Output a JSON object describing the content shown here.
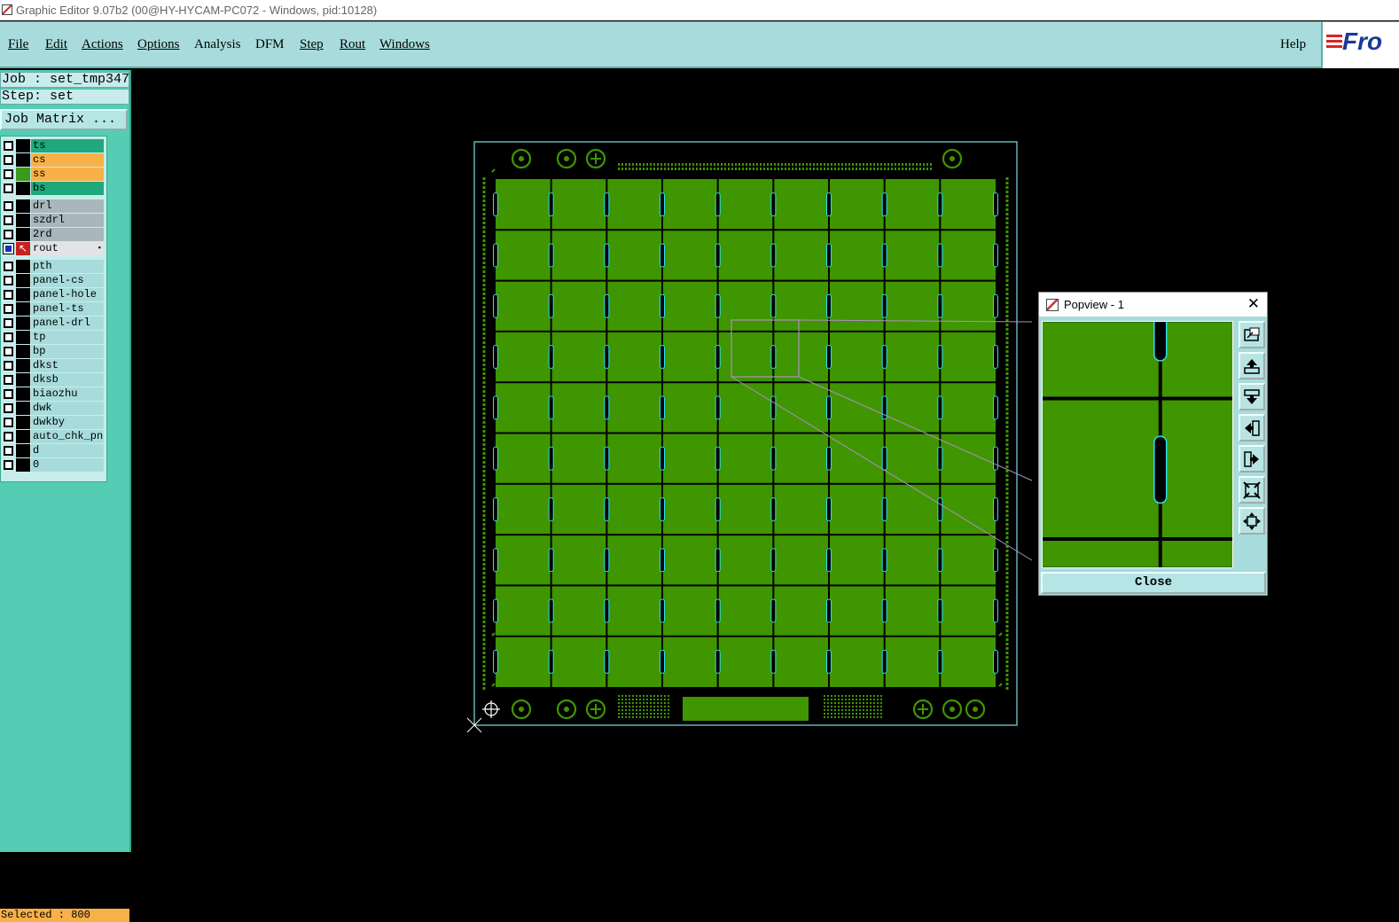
{
  "window": {
    "title": "Graphic Editor 9.07b2 (00@HY-HYCAM-PC072 - Windows, pid:10128)"
  },
  "menu": {
    "items": [
      "File",
      "Edit",
      "Actions",
      "Options",
      "Analysis",
      "DFM",
      "Step",
      "Rout",
      "Windows"
    ],
    "help": "Help",
    "logo_text": "Fro"
  },
  "job": {
    "line": "Job : set_tmp347",
    "step_line": "Step: set",
    "matrix_button": "Job Matrix ..."
  },
  "layers": [
    {
      "name": "ts",
      "color": "#1fa87c",
      "swatch": "#000",
      "active": false
    },
    {
      "name": "cs",
      "color": "#f8b048",
      "swatch": "#000",
      "active": false
    },
    {
      "name": "ss",
      "color": "#f8b048",
      "swatch": "#3a9a1a",
      "active": false
    },
    {
      "name": "bs",
      "color": "#1fa87c",
      "swatch": "#000",
      "active": false
    },
    {
      "name": "drl",
      "color": "#a9b6bb",
      "swatch": "#000",
      "active": false
    },
    {
      "name": "szdrl",
      "color": "#a9b6bb",
      "swatch": "#000",
      "active": false
    },
    {
      "name": "2rd",
      "color": "#a9b6bb",
      "swatch": "#000",
      "active": false
    },
    {
      "name": "rout",
      "color": "#e0e4e4",
      "swatch": "#c82020",
      "active": true
    },
    {
      "name": "pth",
      "color": "#a8dcdc",
      "swatch": "#000",
      "active": false
    },
    {
      "name": "panel-cs",
      "color": "#a8dcdc",
      "swatch": "#000",
      "active": false
    },
    {
      "name": "panel-hole",
      "color": "#a8dcdc",
      "swatch": "#000",
      "active": false
    },
    {
      "name": "panel-ts",
      "color": "#a8dcdc",
      "swatch": "#000",
      "active": false
    },
    {
      "name": "panel-drl",
      "color": "#a8dcdc",
      "swatch": "#000",
      "active": false
    },
    {
      "name": "tp",
      "color": "#a8dcdc",
      "swatch": "#000",
      "active": false
    },
    {
      "name": "bp",
      "color": "#a8dcdc",
      "swatch": "#000",
      "active": false
    },
    {
      "name": "dkst",
      "color": "#a8dcdc",
      "swatch": "#000",
      "active": false
    },
    {
      "name": "dksb",
      "color": "#a8dcdc",
      "swatch": "#000",
      "active": false
    },
    {
      "name": "biaozhu",
      "color": "#a8dcdc",
      "swatch": "#000",
      "active": false
    },
    {
      "name": "dwk",
      "color": "#a8dcdc",
      "swatch": "#000",
      "active": false
    },
    {
      "name": "dwkby",
      "color": "#a8dcdc",
      "swatch": "#000",
      "active": false
    },
    {
      "name": "auto_chk_pnl",
      "color": "#a8dcdc",
      "swatch": "#000",
      "active": false
    },
    {
      "name": "d",
      "color": "#a8dcdc",
      "swatch": "#000",
      "active": false
    },
    {
      "name": "0",
      "color": "#a8dcdc",
      "swatch": "#000",
      "active": false
    }
  ],
  "status": {
    "selected": "Selected : 800"
  },
  "popview": {
    "title": "Popview - 1",
    "close_label": "Close",
    "tools": [
      "zoom-window-icon",
      "pan-up-icon",
      "pan-down-icon",
      "pan-left-icon",
      "pan-right-icon",
      "zoom-out-icon",
      "zoom-fit-icon"
    ]
  },
  "board": {
    "rows": 10,
    "cols": 9,
    "copper_color": "#3f9600",
    "slot_color": "#2ee0f0",
    "outline_color": "#7ee0e0",
    "mark_color": "#3f9600"
  }
}
